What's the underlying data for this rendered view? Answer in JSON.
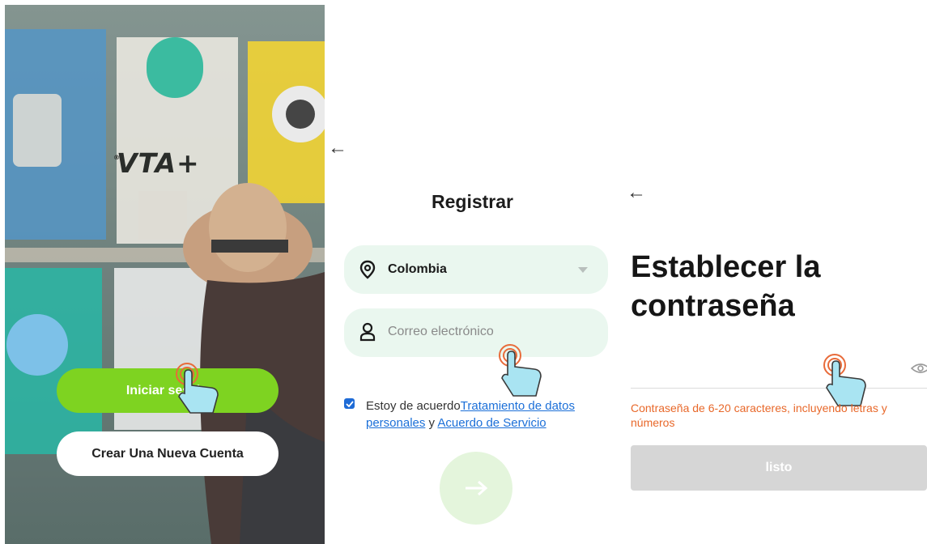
{
  "screens": {
    "welcome": {
      "brand_logo_text": "VTA+",
      "brand_registered_mark": "®",
      "login_button": "Iniciar sesión",
      "create_account_button": "Crear Una Nueva Cuenta"
    },
    "register": {
      "back_arrow": "←",
      "title": "Registrar",
      "country_value": "Colombia",
      "email_placeholder": "Correo electrónico",
      "agreement_text": "Estoy de acuerdo",
      "agreement_link_1": "Tratamiento de datos personales",
      "agreement_connector": " y ",
      "agreement_link_2": "Acuerdo de Servicio",
      "next_arrow": "→"
    },
    "set_password": {
      "back_arrow": "←",
      "title": "Establecer la contraseña",
      "hint": "Contraseña de 6-20 caracteres, incluyendo letras y números",
      "done_button": "listo"
    }
  },
  "colors": {
    "primary_green": "#7ed321",
    "field_bg": "#eaf7ef",
    "link_blue": "#1b6fd8",
    "hint_orange": "#e8682a",
    "disabled_gray": "#d6d6d6"
  },
  "icons": [
    "location-pin-icon",
    "user-icon",
    "chevron-down-icon",
    "checkbox-checked-icon",
    "arrow-right-icon",
    "eye-icon",
    "back-arrow-icon",
    "tap-hand-icon"
  ]
}
